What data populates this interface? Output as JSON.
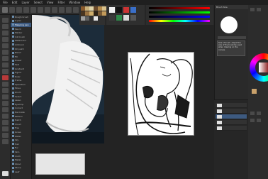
{
  "app": {
    "menu": [
      "File",
      "Edit",
      "Layer",
      "Select",
      "View",
      "Filter",
      "Window",
      "Help"
    ]
  },
  "subtools": {
    "items": [
      "Rough brush",
      "G-pen",
      "Mapping pen",
      "Pencil",
      "Marker",
      "Ink brush",
      "Watercolor",
      "Airbrush",
      "Oil paint",
      "Blend",
      "Fill",
      "Eraser",
      "Text",
      "Gradient",
      "Figure",
      "Ruler",
      "Frame",
      "Operation",
      "Move",
      "Zoom",
      "Select",
      "Lasso",
      "Eyedrop",
      "Correct",
      "Decorate",
      "Pattern",
      "Hatch",
      "Cloud",
      "Tree",
      "Grass",
      "Water",
      "Sky",
      "Hair",
      "Fur",
      "Skin",
      "Cloth",
      "Metal",
      "Wood",
      "Stone",
      "Leaf"
    ],
    "selected_index": 2
  },
  "right_panel": {
    "header": "Brush Size",
    "tooltip": "Size of brush. Adjust the size of the brush tip used when drawing on the canvas."
  },
  "colors": {
    "accent": "#3d5a80",
    "danger": "#b83a3a"
  }
}
